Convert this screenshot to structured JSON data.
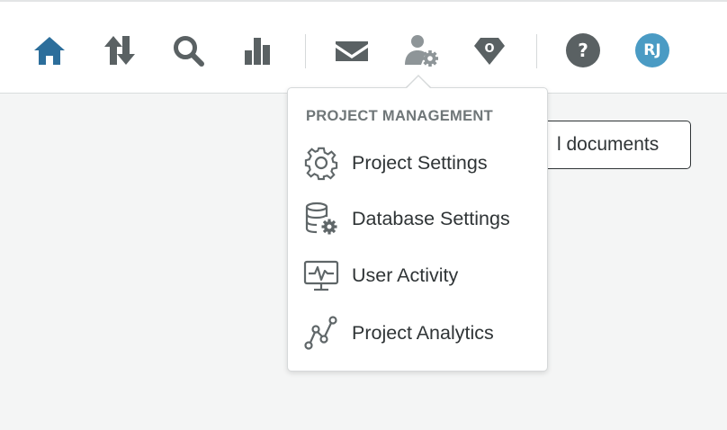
{
  "colors": {
    "nav_active": "#2c6e9b",
    "nav_icon": "#5a6163",
    "nav_icon_muted": "#8e9598",
    "avatar_bg": "#4a9bc4",
    "menu_icon": "#5f6668"
  },
  "nav": {
    "items": [
      {
        "id": "home",
        "icon": "home-icon",
        "active": true
      },
      {
        "id": "transfer",
        "icon": "transfer-arrows-icon"
      },
      {
        "id": "search",
        "icon": "search-icon"
      },
      {
        "id": "reports",
        "icon": "bar-chart-icon"
      },
      {
        "id": "messages",
        "icon": "envelope-icon"
      },
      {
        "id": "project-management",
        "icon": "user-gear-icon",
        "open": true
      },
      {
        "id": "badge",
        "icon": "gem-badge-icon",
        "badge_text": "O"
      },
      {
        "id": "help",
        "icon": "help-icon",
        "badge_text": "?"
      }
    ],
    "avatar_initials": "RJ"
  },
  "background_button": {
    "label": "l documents"
  },
  "dropdown": {
    "header": "PROJECT MANAGEMENT",
    "items": [
      {
        "label": "Project Settings",
        "icon": "gear-icon"
      },
      {
        "label": "Database Settings",
        "icon": "database-gear-icon"
      },
      {
        "label": "User Activity",
        "icon": "monitor-activity-icon"
      },
      {
        "label": "Project Analytics",
        "icon": "analytics-graph-icon"
      }
    ]
  }
}
